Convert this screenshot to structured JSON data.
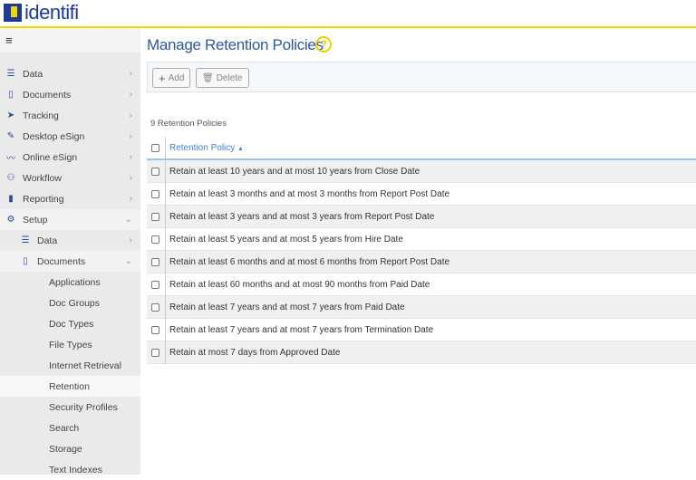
{
  "app": {
    "logo_text": "identifi"
  },
  "sidebar": {
    "items": [
      {
        "label": "Data",
        "icon": "database-icon"
      },
      {
        "label": "Documents",
        "icon": "clipboard-icon"
      },
      {
        "label": "Tracking",
        "icon": "paper-plane-icon"
      },
      {
        "label": "Desktop eSign",
        "icon": "pen-icon"
      },
      {
        "label": "Online eSign",
        "icon": "signature-icon"
      },
      {
        "label": "Workflow",
        "icon": "sitemap-icon"
      },
      {
        "label": "Reporting",
        "icon": "file-icon"
      },
      {
        "label": "Setup",
        "icon": "gear-icon"
      }
    ],
    "setup_children": [
      {
        "label": "Data"
      },
      {
        "label": "Documents"
      }
    ],
    "documents_children": [
      "Applications",
      "Doc Groups",
      "Doc Types",
      "File Types",
      "Internet Retrieval",
      "Retention",
      "Security Profiles",
      "Search",
      "Storage",
      "Text Indexes"
    ]
  },
  "page": {
    "title": "Manage Retention Policies",
    "help": "?"
  },
  "toolbar": {
    "add_label": "Add",
    "delete_label": "Delete"
  },
  "table": {
    "count_label": "9 Retention Policies",
    "header": "Retention Policy",
    "rows": [
      "Retain at least 10 years and at most 10 years from Close Date",
      "Retain at least 3 months and at most 3 months from Report Post Date",
      "Retain at least 3 years and at most 3 years from Report Post Date",
      "Retain at least 5 years and at most 5 years from Hire Date",
      "Retain at least 6 months and at most 6 months from Report Post Date",
      "Retain at least 60 months and at most 90 months from Paid Date",
      "Retain at least 7 years and at most 7 years from Paid Date",
      "Retain at least 7 years and at most 7 years from Termination Date",
      "Retain at most 7 days from Approved Date"
    ]
  }
}
